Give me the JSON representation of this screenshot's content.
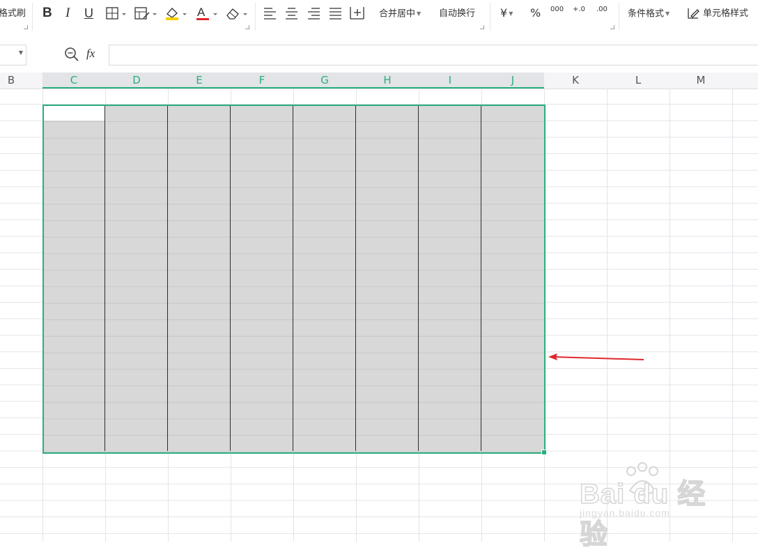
{
  "ribbon": {
    "format_painter_label": "格式刷",
    "bold_label": "B",
    "italic_label": "I",
    "underline_label": "U",
    "font_color_letter": "A",
    "merge_center_label": "合并居中",
    "wrap_text_label": "自动换行",
    "currency_symbol": "¥",
    "percent_symbol": "%",
    "thousands_label": "000",
    "inc_decimal_label": "+.0",
    "dec_decimal_label": ".00",
    "conditional_format_label": "条件格式",
    "cell_style_label": "单元格样式"
  },
  "formula_bar": {
    "fx_label": "fx",
    "value": ""
  },
  "columns": [
    {
      "label": "B"
    },
    {
      "label": "C"
    },
    {
      "label": "D"
    },
    {
      "label": "E"
    },
    {
      "label": "F"
    },
    {
      "label": "G"
    },
    {
      "label": "H"
    },
    {
      "label": "I"
    },
    {
      "label": "J"
    },
    {
      "label": "K"
    },
    {
      "label": "L"
    },
    {
      "label": "M"
    }
  ],
  "selection": {
    "start_column": "C",
    "end_column": "J",
    "accent_color": "#2bae7c",
    "fill_color": "#d8d8d8"
  },
  "annotation": {
    "arrow_color": "#e0262c"
  },
  "watermark": {
    "brand": "Bai du 经验",
    "url": "jingyan.baidu.com"
  }
}
